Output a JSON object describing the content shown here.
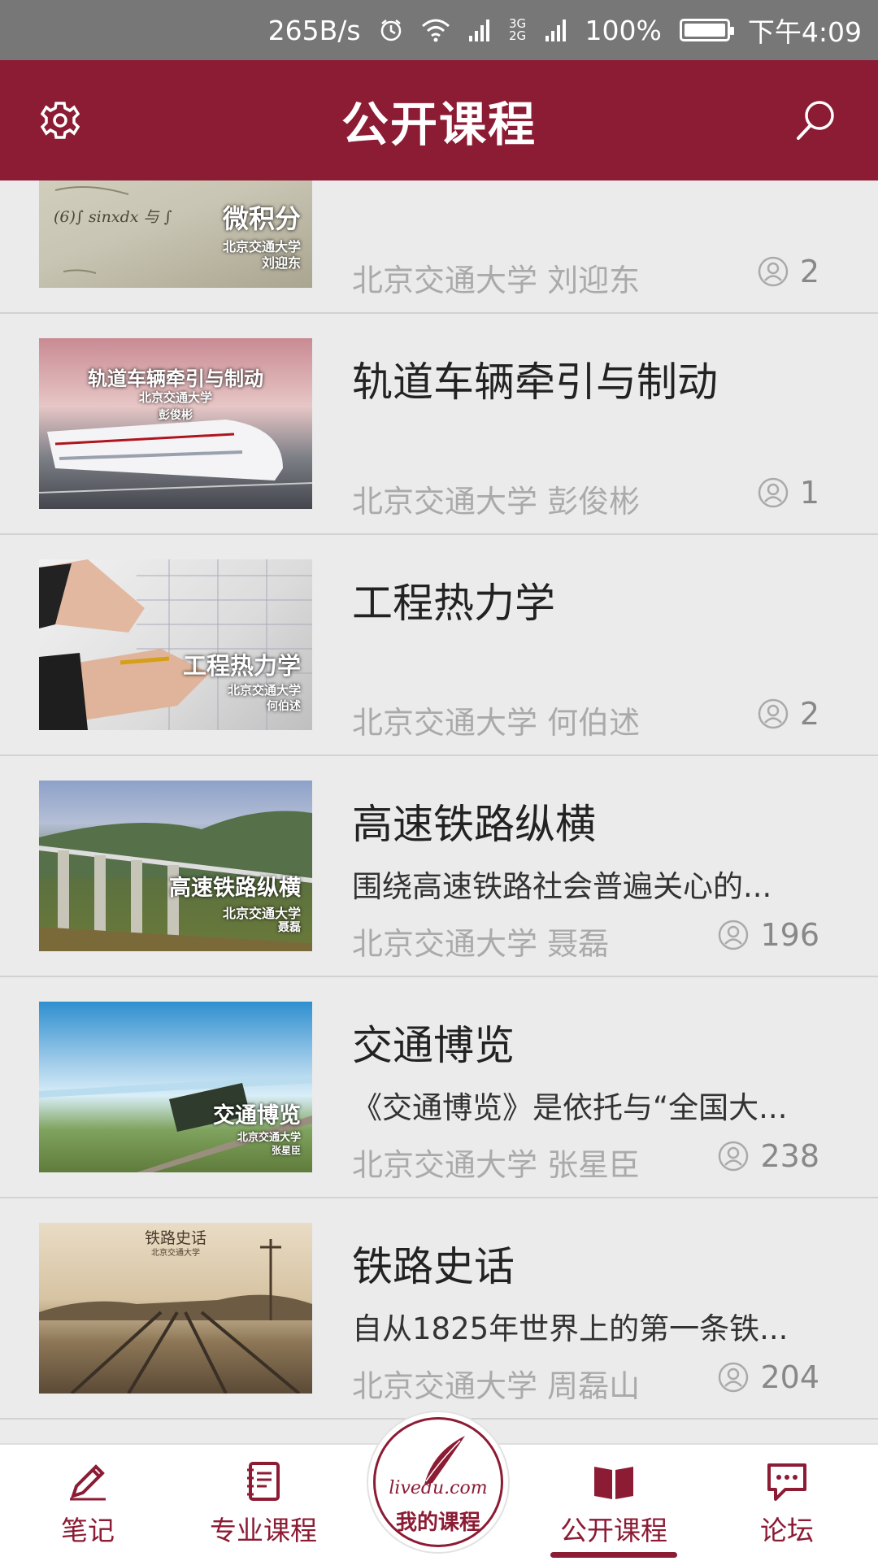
{
  "status_bar": {
    "speed": "265B/s",
    "network": "3G 2G",
    "battery": "100%",
    "battery_level": 1.0,
    "time": "下午4:09"
  },
  "header": {
    "title": "公开课程",
    "left_icon": "gear-icon",
    "right_icon": "search-icon"
  },
  "courses": [
    {
      "title": "",
      "description": "",
      "meta": "北京交通大学 刘迎东",
      "count": "2",
      "thumb_title": "微积分",
      "thumb_school": "北京交通大学",
      "thumb_teacher": "刘迎东",
      "thumb_formula": "(6)∫ sinxdx 与 ∫"
    },
    {
      "title": "轨道车辆牵引与制动",
      "description": "",
      "meta": "北京交通大学 彭俊彬",
      "count": "1",
      "thumb_title": "轨道车辆牵引与制动",
      "thumb_school": "北京交通大学",
      "thumb_teacher": "彭俊彬"
    },
    {
      "title": "工程热力学",
      "description": "",
      "meta": "北京交通大学 何伯述",
      "count": "2",
      "thumb_title": "工程热力学",
      "thumb_school": "北京交通大学",
      "thumb_teacher": "何伯述"
    },
    {
      "title": "高速铁路纵横",
      "description": "围绕高速铁路社会普遍关心的...",
      "meta": "北京交通大学 聂磊",
      "count": "196",
      "thumb_title": "高速铁路纵横",
      "thumb_school": "北京交通大学",
      "thumb_teacher": "聂磊"
    },
    {
      "title": "交通博览",
      "description": "《交通博览》是依托与“全国大...",
      "meta": "北京交通大学 张星臣",
      "count": "238",
      "thumb_title": "交通博览",
      "thumb_school": "北京交通大学",
      "thumb_teacher": "张星臣"
    },
    {
      "title": "铁路史话",
      "description": "自从1825年世界上的第一条铁...",
      "meta": "北京交通大学 周磊山",
      "count": "204",
      "thumb_title": "铁路史话",
      "thumb_school": "北京交通大学",
      "thumb_teacher": ""
    }
  ],
  "bottom_nav": {
    "notes": "笔记",
    "major": "专业课程",
    "my_courses": "我的课程",
    "logo_text": "livedu.com",
    "public": "公开课程",
    "forum": "论坛",
    "active": "public"
  },
  "colors": {
    "primary": "#8c1b34",
    "status_bar": "#777777",
    "background": "#ebebeb"
  }
}
